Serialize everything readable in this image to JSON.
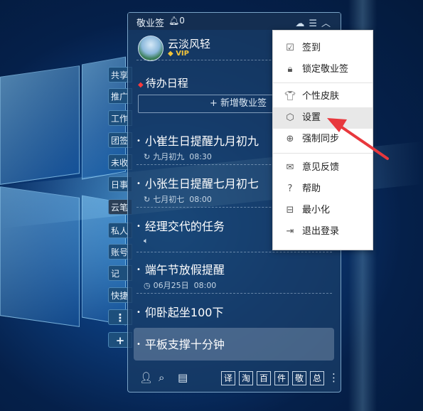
{
  "widget": {
    "title": "敬业签",
    "bell_count": "0",
    "user": {
      "name": "云淡风轻",
      "badge": "VIP"
    },
    "section_title": "待办日程",
    "new_button": "+ 新增敬业签",
    "items": [
      {
        "title": "小崔生日提醒九月初九",
        "meta_date": "九月初九",
        "meta_time": "08:30",
        "meta_icon": "repeat-icon"
      },
      {
        "title": "小张生日提醒七月初七",
        "meta_date": "七月初七",
        "meta_time": "08:00",
        "meta_icon": "repeat-icon"
      },
      {
        "title": "经理交代的任务",
        "meta_icon": "speaker-icon"
      },
      {
        "title": "端午节放假提醒",
        "meta_date": "06月25日",
        "meta_time": "08:00",
        "meta_icon": "clock-icon"
      },
      {
        "title": "仰卧起坐100下"
      },
      {
        "title": "平板支撑十分钟"
      }
    ],
    "bottom_buttons": [
      "译",
      "淘",
      "百",
      "件",
      "敬",
      "总"
    ]
  },
  "side_tabs": [
    "共享",
    "推广",
    "工作",
    "团签",
    "未收",
    "日事",
    "云笔",
    "私人",
    "账号",
    "记",
    "快捷",
    "⋮",
    "+"
  ],
  "menu": {
    "items": [
      {
        "label": "签到",
        "icon": "checkbox-icon"
      },
      {
        "label": "锁定敬业签",
        "icon": "lock-icon"
      },
      {
        "label": "个性皮肤",
        "icon": "shirt-icon"
      },
      {
        "label": "设置",
        "icon": "gear-icon",
        "active": true
      },
      {
        "label": "强制同步",
        "icon": "sync-up-icon"
      },
      {
        "label": "意见反馈",
        "icon": "mail-icon"
      },
      {
        "label": "帮助",
        "icon": "help-icon"
      },
      {
        "label": "最小化",
        "icon": "minimize-icon"
      },
      {
        "label": "退出登录",
        "icon": "logout-icon"
      }
    ]
  },
  "colors": {
    "accent_red": "#e8383d",
    "widget_bg": "#183c66",
    "vip_gold": "#f3c53a"
  }
}
